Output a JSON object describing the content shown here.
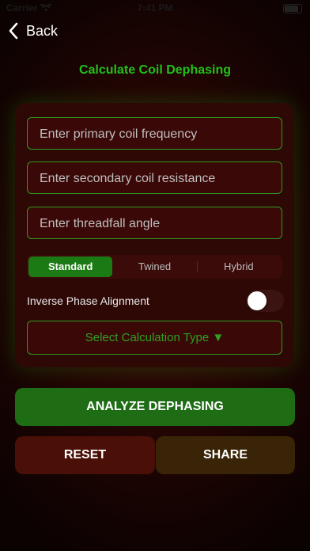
{
  "status_bar": {
    "carrier": "Carrier",
    "time": "7:41 PM"
  },
  "nav": {
    "back_label": "Back"
  },
  "page": {
    "title": "Calculate Coil Dephasing"
  },
  "form": {
    "primary_frequency_placeholder": "Enter primary coil frequency",
    "secondary_resistance_placeholder": "Enter secondary coil resistance",
    "threadfall_angle_placeholder": "Enter threadfall angle",
    "mode_options": [
      "Standard",
      "Twined",
      "Hybrid"
    ],
    "mode_selected": "Standard",
    "inverse_phase_label": "Inverse Phase Alignment",
    "inverse_phase_on": false,
    "calculation_type_label": "Select Calculation Type ▼"
  },
  "actions": {
    "analyze_label": "ANALYZE DEPHASING",
    "reset_label": "RESET",
    "share_label": "SHARE"
  },
  "colors": {
    "accent_green": "#22c01a",
    "button_green": "#1e6c14",
    "reset_red": "#4a0f07",
    "share_brown": "#3a2408"
  }
}
